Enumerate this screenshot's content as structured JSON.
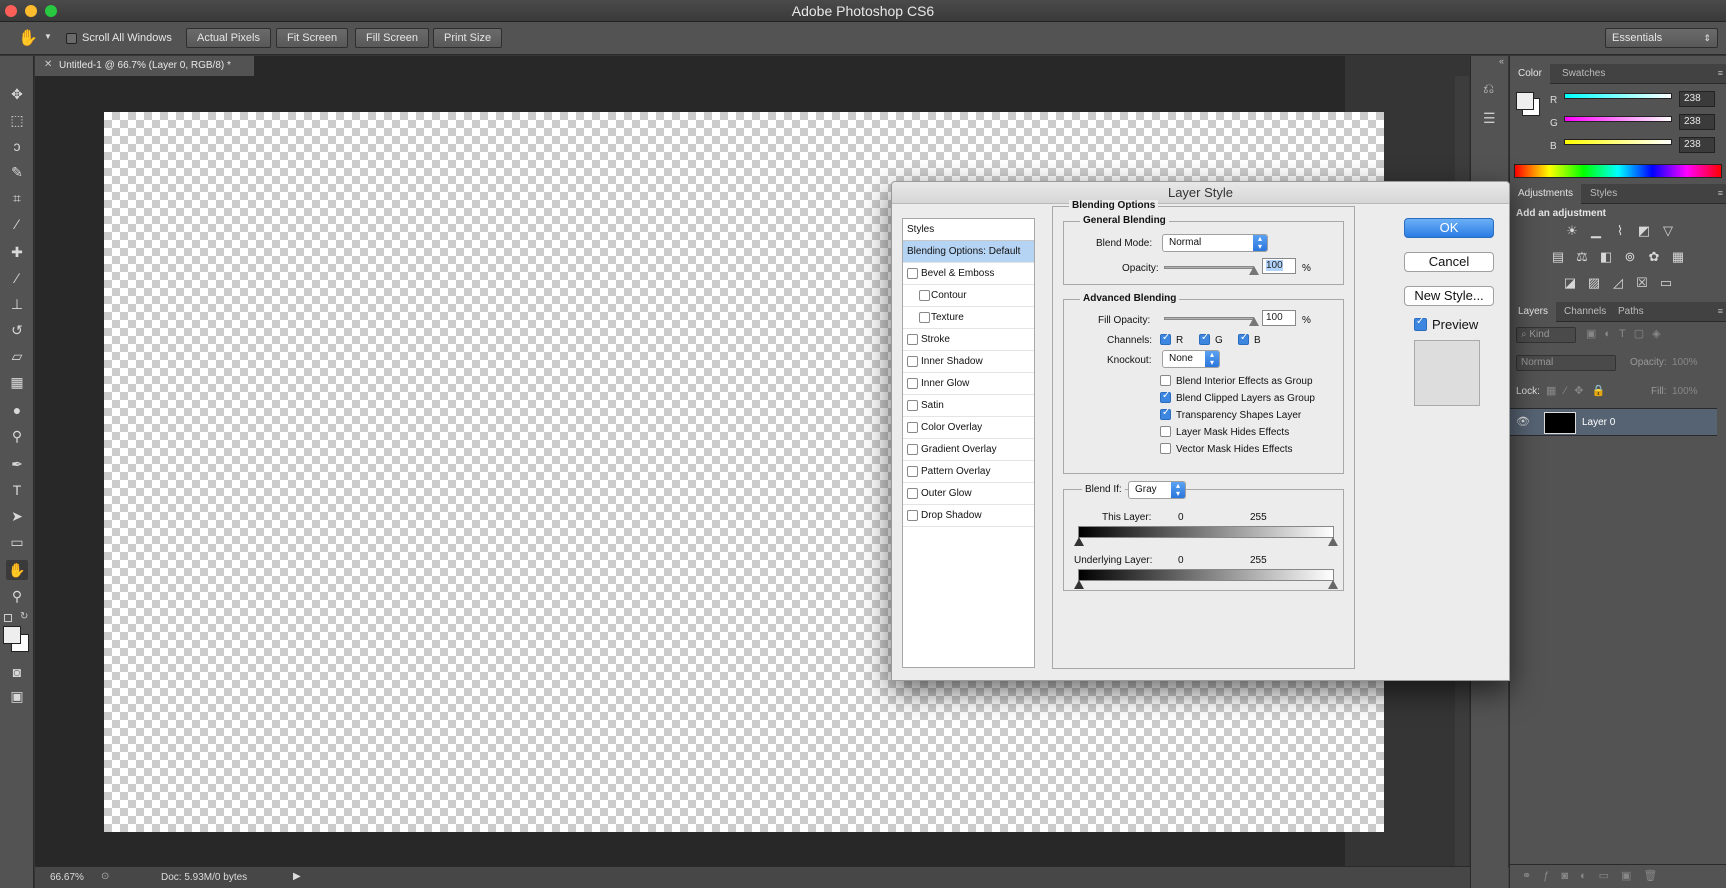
{
  "app": {
    "title": "Adobe Photoshop CS6"
  },
  "options_bar": {
    "scroll_all_windows": "Scroll All Windows",
    "actual_pixels": "Actual Pixels",
    "fit_screen": "Fit Screen",
    "fill_screen": "Fill Screen",
    "print_size": "Print Size",
    "workspace": "Essentials"
  },
  "document": {
    "tab_title": "Untitled-1 @ 66.7% (Layer 0, RGB/8) *",
    "zoom": "66.67%",
    "doc_info": "Doc: 5.93M/0 bytes"
  },
  "color_panel": {
    "tabs": [
      "Color",
      "Swatches"
    ],
    "channels": [
      {
        "label": "R",
        "value": "238"
      },
      {
        "label": "G",
        "value": "238"
      },
      {
        "label": "B",
        "value": "238"
      }
    ]
  },
  "adjustments_panel": {
    "tabs": [
      "Adjustments",
      "Styles"
    ],
    "heading": "Add an adjustment"
  },
  "layers_panel": {
    "tabs": [
      "Layers",
      "Channels",
      "Paths"
    ],
    "filter": "Kind",
    "blend_mode": "Normal",
    "opacity_label": "Opacity:",
    "opacity_value": "100%",
    "lock_label": "Lock:",
    "fill_label": "Fill:",
    "fill_value": "100%",
    "layers": [
      {
        "name": "Layer 0"
      }
    ]
  },
  "layer_style_dialog": {
    "title": "Layer Style",
    "styles_header": "Styles",
    "style_items": [
      {
        "label": "Blending Options: Default",
        "checkbox": false,
        "checked": false,
        "indent": false,
        "selected": true
      },
      {
        "label": "Bevel & Emboss",
        "checkbox": true,
        "checked": false,
        "indent": false,
        "selected": false
      },
      {
        "label": "Contour",
        "checkbox": true,
        "checked": false,
        "indent": true,
        "selected": false
      },
      {
        "label": "Texture",
        "checkbox": true,
        "checked": false,
        "indent": true,
        "selected": false
      },
      {
        "label": "Stroke",
        "checkbox": true,
        "checked": false,
        "indent": false,
        "selected": false
      },
      {
        "label": "Inner Shadow",
        "checkbox": true,
        "checked": false,
        "indent": false,
        "selected": false
      },
      {
        "label": "Inner Glow",
        "checkbox": true,
        "checked": false,
        "indent": false,
        "selected": false
      },
      {
        "label": "Satin",
        "checkbox": true,
        "checked": false,
        "indent": false,
        "selected": false
      },
      {
        "label": "Color Overlay",
        "checkbox": true,
        "checked": false,
        "indent": false,
        "selected": false
      },
      {
        "label": "Gradient Overlay",
        "checkbox": true,
        "checked": false,
        "indent": false,
        "selected": false
      },
      {
        "label": "Pattern Overlay",
        "checkbox": true,
        "checked": false,
        "indent": false,
        "selected": false
      },
      {
        "label": "Outer Glow",
        "checkbox": true,
        "checked": false,
        "indent": false,
        "selected": false
      },
      {
        "label": "Drop Shadow",
        "checkbox": true,
        "checked": false,
        "indent": false,
        "selected": false
      }
    ],
    "blending_options": "Blending Options",
    "general_blending": "General Blending",
    "blend_mode_label": "Blend Mode:",
    "blend_mode_value": "Normal",
    "opacity_label": "Opacity:",
    "opacity_value": "100",
    "percent": "%",
    "advanced_blending": "Advanced Blending",
    "fill_opacity_label": "Fill Opacity:",
    "fill_opacity_value": "100",
    "channels_label": "Channels:",
    "channels": [
      {
        "label": "R",
        "checked": true
      },
      {
        "label": "G",
        "checked": true
      },
      {
        "label": "B",
        "checked": true
      }
    ],
    "knockout_label": "Knockout:",
    "knockout_value": "None",
    "options": [
      {
        "label": "Blend Interior Effects as Group",
        "checked": false
      },
      {
        "label": "Blend Clipped Layers as Group",
        "checked": true
      },
      {
        "label": "Transparency Shapes Layer",
        "checked": true
      },
      {
        "label": "Layer Mask Hides Effects",
        "checked": false
      },
      {
        "label": "Vector Mask Hides Effects",
        "checked": false
      }
    ],
    "blend_if_label": "Blend If:",
    "blend_if_value": "Gray",
    "this_layer_label": "This Layer:",
    "underlying_layer_label": "Underlying Layer:",
    "range_min": "0",
    "range_max": "255",
    "buttons": {
      "ok": "OK",
      "cancel": "Cancel",
      "new_style": "New Style..."
    },
    "preview_label": "Preview",
    "preview_checked": true
  }
}
